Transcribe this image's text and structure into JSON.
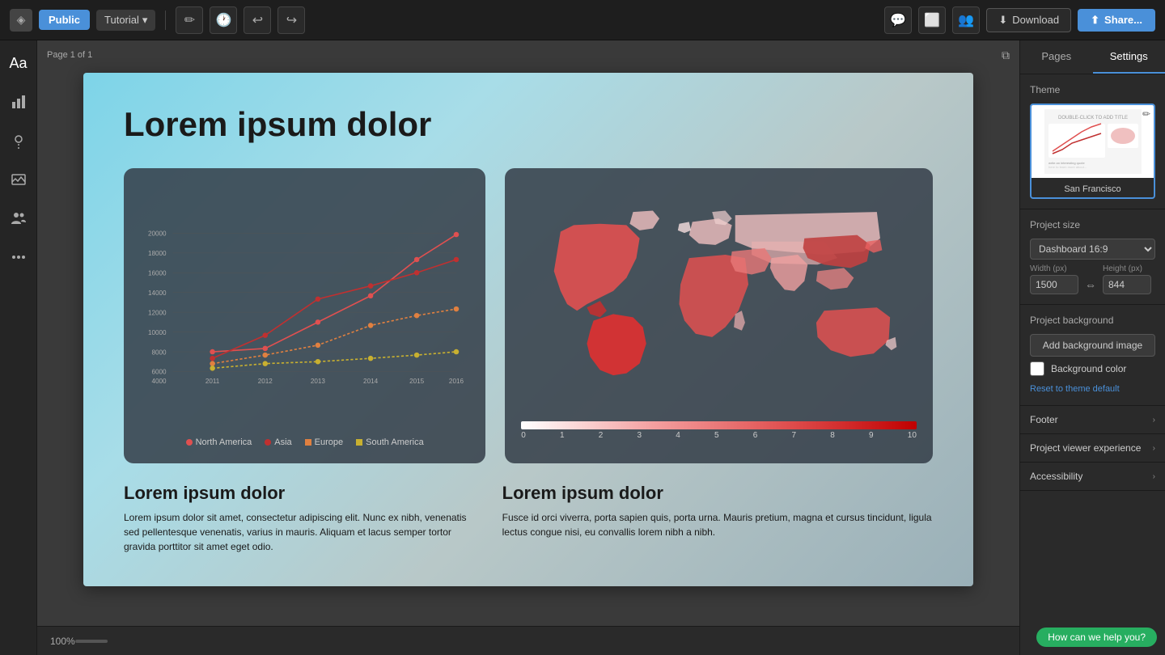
{
  "topbar": {
    "logo_icon": "◈",
    "public_label": "Public",
    "tutorial_label": "Tutorial",
    "undo_icon": "↩",
    "redo_icon": "↪",
    "comment_icon": "💬",
    "chat_icon": "◻",
    "people_icon": "👥",
    "download_icon": "⬇",
    "download_label": "Download",
    "share_icon": "⬆",
    "share_label": "Share..."
  },
  "left_sidebar": {
    "icons": [
      {
        "name": "text-icon",
        "glyph": "Aa"
      },
      {
        "name": "chart-icon",
        "glyph": "📊"
      },
      {
        "name": "map-icon",
        "glyph": "🎯"
      },
      {
        "name": "image-icon",
        "glyph": "🖼"
      },
      {
        "name": "team-icon",
        "glyph": "👥"
      },
      {
        "name": "more-icon",
        "glyph": "•••"
      }
    ]
  },
  "canvas": {
    "page_label": "Page 1 of 1",
    "slide": {
      "title": "Lorem ipsum dolor",
      "chart1": {
        "title": "Lorem ipsum dolor",
        "body": "Lorem ipsum dolor sit amet, consectetur adipiscing elit. Nunc ex nibh, venenatis sed pellentesque venenatis, varius in mauris. Aliquam et lacus semper tortor gravida porttitor sit amet eget odio."
      },
      "chart2": {
        "title": "Lorem ipsum dolor",
        "body": "Fusce id orci viverra, porta sapien quis, porta urna. Mauris pretium, magna et cursus tincidunt, ligula lectus congue nisi, eu convallis lorem nibh a nibh."
      },
      "legend": {
        "items": [
          {
            "label": "North America",
            "color": "#e05050"
          },
          {
            "label": "Asia",
            "color": "#c03030"
          },
          {
            "label": "Europe",
            "color": "#e08040"
          },
          {
            "label": "South America",
            "color": "#c8b030"
          }
        ]
      }
    }
  },
  "right_sidebar": {
    "tabs": [
      {
        "label": "Pages",
        "active": false
      },
      {
        "label": "Settings",
        "active": true
      }
    ],
    "theme_section": {
      "title": "Theme",
      "theme_name": "San Francisco"
    },
    "project_size": {
      "title": "Project size",
      "selected": "Dashboard 16:9",
      "width_label": "Width (px)",
      "height_label": "Height (px)",
      "width_value": "1500",
      "height_value": "844"
    },
    "project_background": {
      "title": "Project background",
      "add_bg_label": "Add background image",
      "bg_color_label": "Background color",
      "reset_label": "Reset to theme default"
    },
    "accordion": {
      "items": [
        {
          "label": "Footer"
        },
        {
          "label": "Project viewer experience"
        },
        {
          "label": "Accessibility"
        }
      ]
    }
  },
  "bottom": {
    "zoom_label": "100%",
    "help_label": "How can we help you?"
  }
}
